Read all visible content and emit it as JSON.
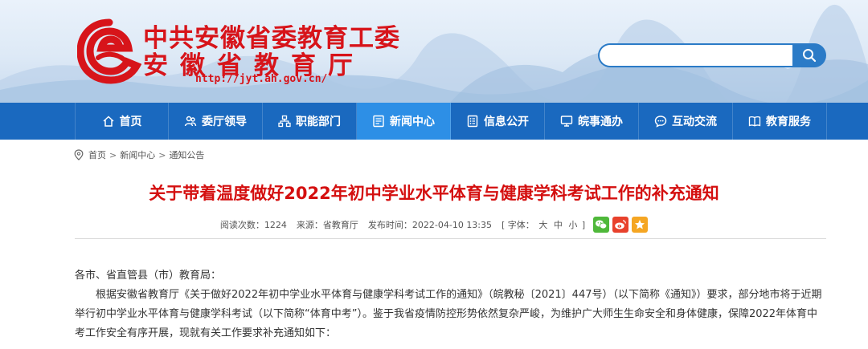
{
  "header": {
    "org_title": "中共安徽省委教育工委",
    "dept_title": "安徽省教育厅",
    "url": "http://jyt.ah.gov.cn/",
    "search_placeholder": "",
    "brand_color": "#d7141a"
  },
  "nav": {
    "items": [
      {
        "label": "首页",
        "icon": "home-icon"
      },
      {
        "label": "委厅领导",
        "icon": "leaders-icon"
      },
      {
        "label": "职能部门",
        "icon": "org-chart-icon"
      },
      {
        "label": "新闻中心",
        "icon": "news-icon",
        "active": true
      },
      {
        "label": "信息公开",
        "icon": "document-list-icon"
      },
      {
        "label": "皖事通办",
        "icon": "monitor-icon"
      },
      {
        "label": "互动交流",
        "icon": "chat-bubble-icon"
      },
      {
        "label": "教育服务",
        "icon": "open-book-icon"
      }
    ],
    "bg_color": "#1a69bf",
    "active_color": "#2d8fe6"
  },
  "breadcrumb": {
    "icon": "location-pin-icon",
    "items": [
      "首页",
      "新闻中心",
      "通知公告"
    ],
    "separator": ">"
  },
  "article": {
    "title": "关于带着温度做好2022年初中学业水平体育与健康学科考试工作的补充通知",
    "title_color": "#d40f0f",
    "meta": {
      "views": "阅读次数：1224",
      "source": "来源：省教育厅",
      "published": "发布时间：2022-04-10 13:35",
      "font_label_open": "[ 字体：",
      "font_sizes": [
        "大",
        "中",
        "小"
      ],
      "font_label_close": "]"
    },
    "share": [
      {
        "name": "wechat",
        "icon": "wechat-icon",
        "color": "#4fb83a"
      },
      {
        "name": "weibo",
        "icon": "weibo-icon",
        "color": "#e8412c"
      },
      {
        "name": "favorite",
        "icon": "star-icon",
        "color": "#f5a623"
      }
    ],
    "salutation": "各市、省直管县（市）教育局：",
    "paragraph": "根据安徽省教育厅《关于做好2022年初中学业水平体育与健康学科考试工作的通知》（皖教秘〔2021〕447号）（以下简称《通知》）要求，部分地市将于近期举行初中学业水平体育与健康学科考试（以下简称“体育中考”）。鉴于我省疫情防控形势依然复杂严峻，为维护广大师生生命安全和身体健康，保障2022年体育中考工作安全有序开展，现就有关工作要求补充通知如下："
  }
}
